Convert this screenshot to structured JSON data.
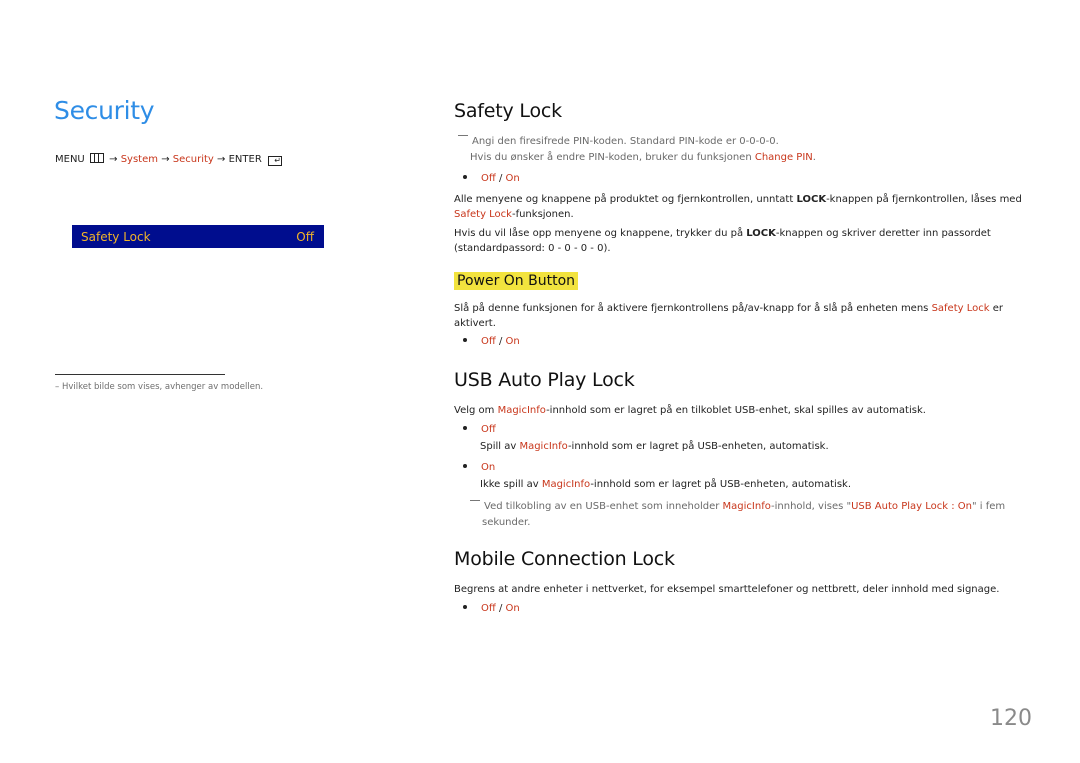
{
  "left": {
    "page_title": "Security",
    "menu_path": {
      "menu": "MENU",
      "arrow": "→",
      "system": "System",
      "security": "Security",
      "enter": "ENTER",
      "enter_glyph": "↵"
    },
    "osd": {
      "label": "Safety Lock",
      "value": "Off"
    },
    "footnote": "–  Hvilket bilde som vises, avhenger av modellen."
  },
  "safety_lock": {
    "heading": "Safety Lock",
    "note_line1": "Angi den firesifrede PIN-koden. Standard PIN-kode er 0-0-0-0.",
    "note_line2_pre": "Hvis du ønsker å endre PIN-koden, bruker du funksjonen ",
    "note_line2_link": "Change PIN",
    "note_line2_post": ".",
    "option_off": "Off",
    "option_sep": " / ",
    "option_on": "On",
    "para1_pre": "Alle menyene og knappene på produktet og fjernkontrollen, unntatt ",
    "para1_bold": "LOCK",
    "para1_mid": "-knappen på fjernkontrollen, låses med ",
    "para1_link": "Safety Lock",
    "para1_post": "-funksjonen.",
    "para2_pre": "Hvis du vil låse opp menyene og knappene, trykker du på ",
    "para2_bold": "LOCK",
    "para2_post": "-knappen og skriver deretter inn passordet (standardpassord: 0 - 0 - 0 - 0)."
  },
  "power_on_button": {
    "heading": "Power On Button",
    "para_pre": "Slå på denne funksjonen for å aktivere fjernkontrollens på/av-knapp for å slå på enheten mens ",
    "para_link": "Safety Lock",
    "para_post": " er aktivert.",
    "option_off": "Off",
    "option_sep": " / ",
    "option_on": "On"
  },
  "usb_auto_play_lock": {
    "heading": "USB Auto Play Lock",
    "para_pre": "Velg om ",
    "para_link": "MagicInfo",
    "para_post": "-innhold som er lagret på en tilkoblet USB-enhet, skal spilles av automatisk.",
    "off_label": "Off",
    "off_desc_pre": "Spill av ",
    "off_desc_link": "MagicInfo",
    "off_desc_post": "-innhold som er lagret på USB-enheten, automatisk.",
    "on_label": "On",
    "on_desc_pre": "Ikke spill av ",
    "on_desc_link": "MagicInfo",
    "on_desc_post": "-innhold som er lagret på USB-enheten, automatisk.",
    "note_pre": "Ved tilkobling av en USB-enhet som inneholder ",
    "note_link": "MagicInfo",
    "note_mid": "-innhold, vises \"",
    "note_link2": "USB Auto Play Lock : On",
    "note_post": "\" i fem sekunder."
  },
  "mobile_connection_lock": {
    "heading": "Mobile Connection Lock",
    "para": "Begrens at andre enheter i nettverket, for eksempel smarttelefoner og nettbrett, deler innhold med signage.",
    "option_off": "Off",
    "option_sep": " / ",
    "option_on": "On"
  },
  "page_number": "120"
}
